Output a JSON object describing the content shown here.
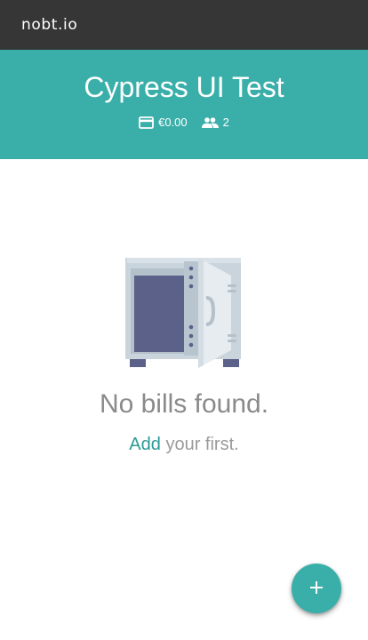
{
  "app": {
    "logo": "nobt.io"
  },
  "header": {
    "title": "Cypress UI Test",
    "balance_icon": "credit-card-icon",
    "balance": "€0.00",
    "members_icon": "people-icon",
    "members_count": "2"
  },
  "empty_state": {
    "illustration": "open-safe-illustration",
    "title": "No bills found.",
    "add_link": "Add",
    "suffix": " your first."
  },
  "fab": {
    "icon": "plus-icon"
  },
  "colors": {
    "topbar": "#363636",
    "accent": "#3aafa9",
    "link": "#2b9a94",
    "muted_text": "#8a8a8a"
  }
}
